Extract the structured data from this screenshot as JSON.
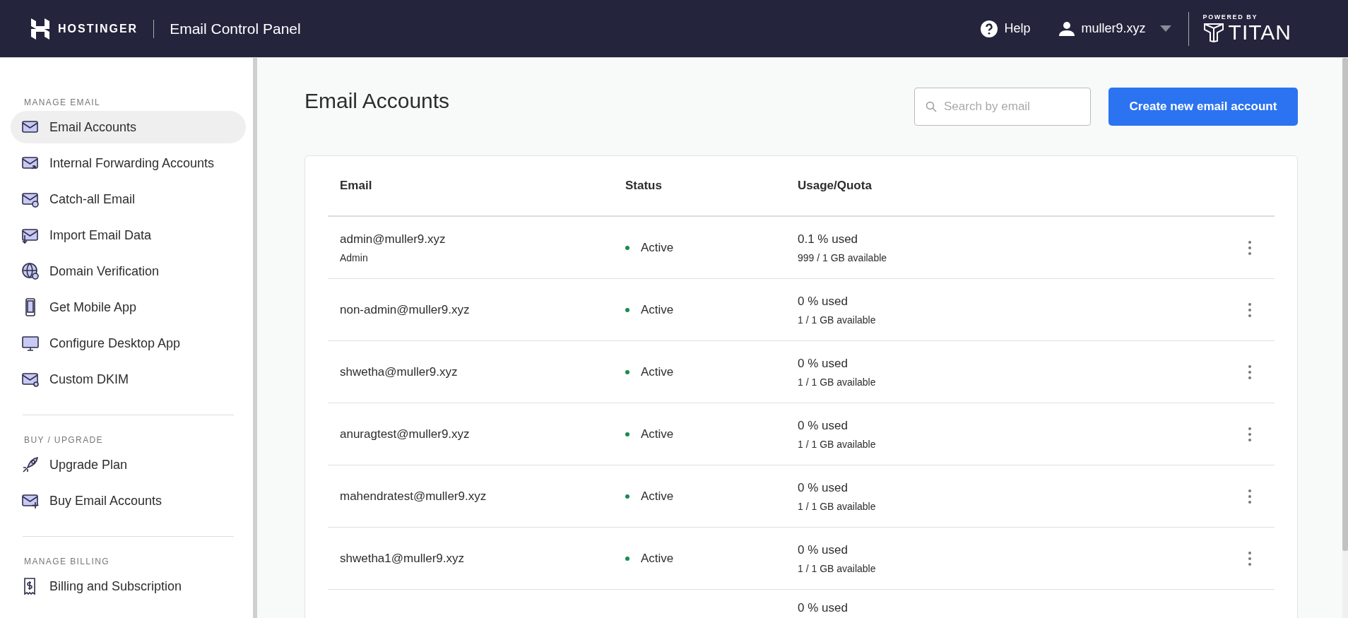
{
  "header": {
    "brand": "HOSTINGER",
    "title": "Email Control Panel",
    "help": "Help",
    "account": "muller9.xyz",
    "powered_by": "POWERED BY",
    "partner": "TITAN"
  },
  "sidebar": {
    "sections": [
      {
        "heading": "MANAGE EMAIL",
        "items": [
          {
            "label": "Email Accounts",
            "kind": "mail",
            "selected": true
          },
          {
            "label": "Internal Forwarding Accounts",
            "kind": "forward",
            "selected": false
          },
          {
            "label": "Catch-all Email",
            "kind": "catchall",
            "selected": false
          },
          {
            "label": "Import Email Data",
            "kind": "import",
            "selected": false
          },
          {
            "label": "Domain Verification",
            "kind": "domain",
            "selected": false
          },
          {
            "label": "Get Mobile App",
            "kind": "mobile",
            "selected": false
          },
          {
            "label": "Configure Desktop App",
            "kind": "desktop",
            "selected": false
          },
          {
            "label": "Custom DKIM",
            "kind": "dkim",
            "selected": false
          }
        ]
      },
      {
        "heading": "BUY / UPGRADE",
        "items": [
          {
            "label": "Upgrade Plan",
            "kind": "upgrade",
            "selected": false
          },
          {
            "label": "Buy Email Accounts",
            "kind": "buy",
            "selected": false
          }
        ]
      },
      {
        "heading": "MANAGE BILLING",
        "items": [
          {
            "label": "Billing and Subscription",
            "kind": "billing",
            "selected": false
          }
        ]
      }
    ]
  },
  "page": {
    "title": "Email Accounts",
    "search": {
      "placeholder": "Search by email"
    },
    "create_button": "Create new email account"
  },
  "table": {
    "columns": [
      "Email",
      "Status",
      "Usage/Quota"
    ],
    "rows": [
      {
        "email": "admin@muller9.xyz",
        "role": "Admin",
        "status": "Active",
        "used": "0.1 % used",
        "available": "999 / 1 GB available"
      },
      {
        "email": "non-admin@muller9.xyz",
        "status": "Active",
        "used": "0 % used",
        "available": "1 / 1 GB available"
      },
      {
        "email": "shwetha@muller9.xyz",
        "status": "Active",
        "used": "0 % used",
        "available": "1 / 1 GB available"
      },
      {
        "email": "anuragtest@muller9.xyz",
        "status": "Active",
        "used": "0 % used",
        "available": "1 / 1 GB available"
      },
      {
        "email": "mahendratest@muller9.xyz",
        "status": "Active",
        "used": "0 % used",
        "available": "1 / 1 GB available"
      },
      {
        "email": "shwetha1@muller9.xyz",
        "status": "Active",
        "used": "0 % used",
        "available": "1 / 1 GB available"
      },
      {
        "used": "0 % used"
      }
    ]
  }
}
